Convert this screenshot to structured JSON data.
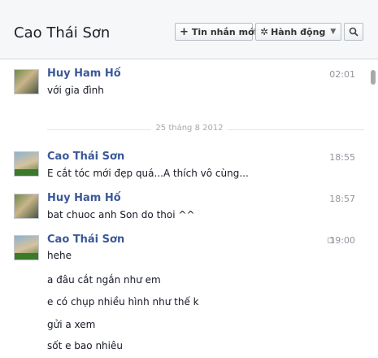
{
  "header": {
    "title": "Cao Thái Sơn",
    "new_message_label": "Tin nhắn mới",
    "actions_label": "Hành động"
  },
  "divider": {
    "label": "25 tháng 8 2012"
  },
  "messages": [
    {
      "sender": "Huy Ham Hố",
      "time": "02:01",
      "lines": [
        "với gia đình"
      ]
    },
    {
      "sender": "Cao Thái Sơn",
      "time": "18:55",
      "lines": [
        "E cắt tóc mới đẹp quá...A thích vô cùng..."
      ]
    },
    {
      "sender": "Huy Ham Hố",
      "time": "18:57",
      "lines": [
        "bat chuoc anh Son do thoi ^^"
      ]
    },
    {
      "sender": "Cao Thái Sơn",
      "time": "19:00",
      "lines": [
        "hehe",
        "a đâu cắt ngắn như em",
        "e có chụp nhiều hình như thế k",
        "gửi a xem",
        "sốt e bao nhiêu"
      ]
    }
  ],
  "icons": {
    "new_message": "plus-icon",
    "actions": "gear-icon",
    "dropdown": "caret-down-icon",
    "search": "search-icon",
    "message_status": "message-icon"
  }
}
